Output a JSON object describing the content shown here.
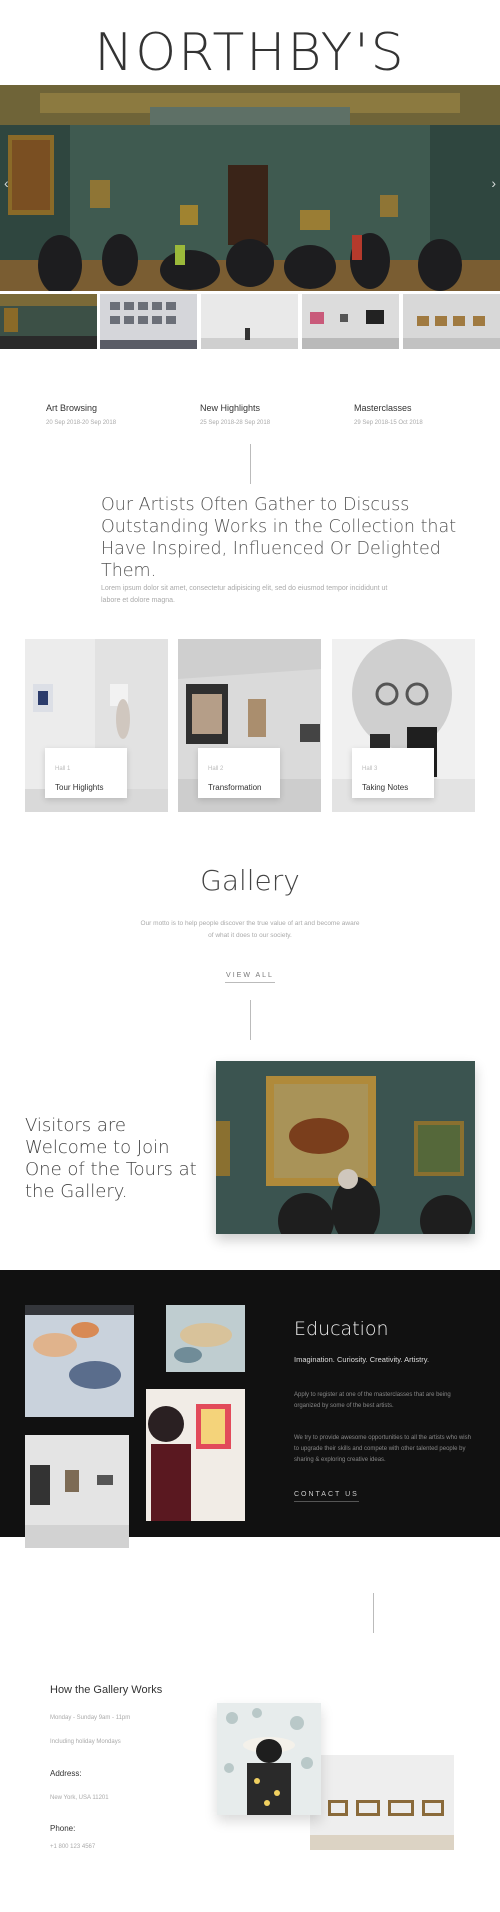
{
  "brand": {
    "name": "NORTHBY'S"
  },
  "hero": {
    "prev_icon": "chevron-left-icon",
    "next_icon": "chevron-right-icon",
    "prev_glyph": "‹",
    "next_glyph": "›"
  },
  "events": [
    {
      "title": "Art Browsing",
      "date": "20 Sep 2018-20 Sep 2018"
    },
    {
      "title": "New Highlights",
      "date": "25 Sep 2018-28 Sep 2018"
    },
    {
      "title": "Masterclasses",
      "date": "29 Sep 2018-15 Oct 2018"
    }
  ],
  "intro": {
    "quote": "Our Artists Often Gather to Discuss Outstanding Works in the Collection that Have Inspired, Influenced Or Delighted Them.",
    "lorem": "Lorem ipsum dolor sit amet, consectetur adipisicing elit, sed do eiusmod tempor incididunt ut labore et dolore magna."
  },
  "halls": [
    {
      "num": "Hall 1",
      "label": "Tour Higlights"
    },
    {
      "num": "Hall 2",
      "label": "Transformation"
    },
    {
      "num": "Hall 3",
      "label": "Taking Notes"
    }
  ],
  "gallery": {
    "title": "Gallery",
    "motto": "Our motto is to help people discover the true value of art and become aware of what it does to our society.",
    "view_all": "VIEW ALL"
  },
  "visitors": {
    "text": "Visitors are Welcome to Join One of the Tours at the Gallery."
  },
  "education": {
    "title": "Education",
    "subtitle": "Imagination. Curiosity. Creativity. Artistry.",
    "p1": "Apply to register at one of the masterclasses that are being organized by some of the best artists.",
    "p2": "We try to provide awesome opportunities to all the artists who wish to upgrade their skills and compete with other talented people by sharing & exploring creative ideas.",
    "contact": "CONTACT US"
  },
  "works": {
    "title": "How the Gallery Works",
    "hours": "Monday - Sunday 9am - 11pm",
    "hours_note": "Including holiday Mondays",
    "address_label": "Address:",
    "address": "New York, USA 11201",
    "phone_label": "Phone:",
    "phone": "+1 800 123 4567"
  }
}
